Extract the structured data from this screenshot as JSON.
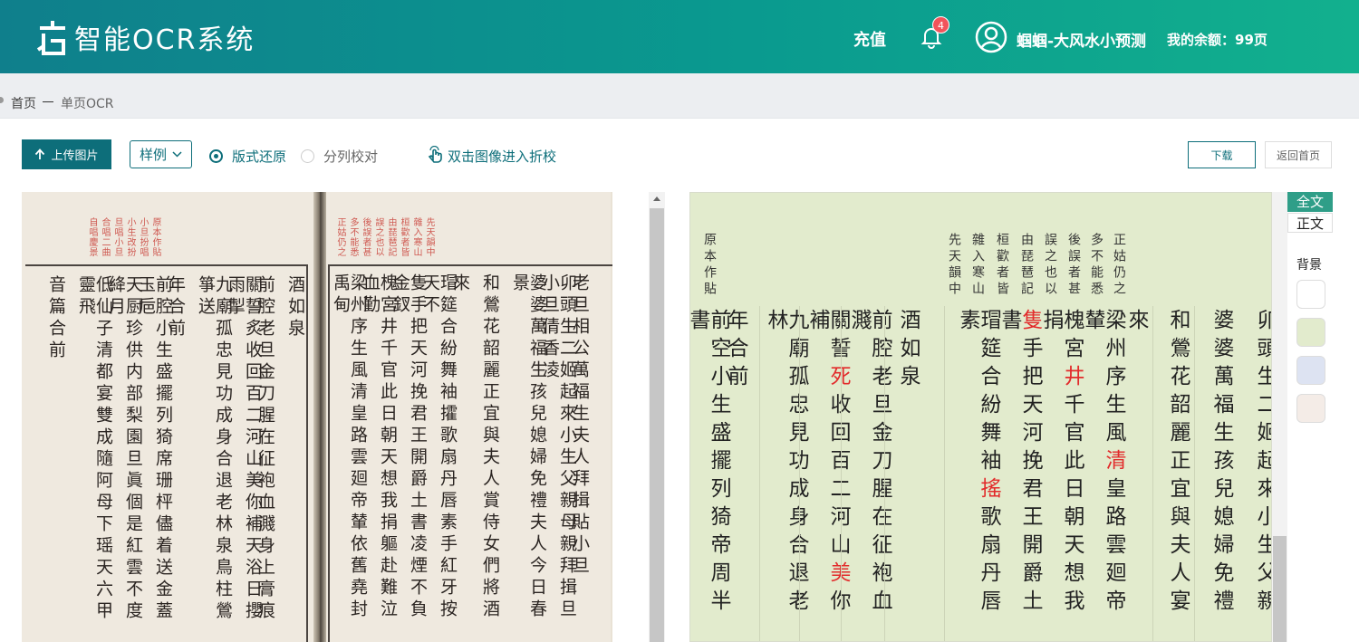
{
  "header": {
    "app_title": "智能OCR系统",
    "recharge": "充值",
    "notification_count": "4",
    "username": "蝈蝈-大风水小预测",
    "balance": "我的余额：99页"
  },
  "breadcrumb": {
    "home": "首页",
    "current": "单页OCR"
  },
  "toolbar": {
    "upload_label": "上传图片",
    "sample_label": "样例",
    "mode_layout": "版式还原",
    "mode_columns": "分列校对",
    "fold_label": "双击图像进入折校",
    "download_label": "下载",
    "home_label": "返回首页"
  },
  "side_tabs": {
    "full": "全文",
    "body": "正文",
    "background_label": "背景"
  },
  "colors": {
    "header_start": "#0f7f8c",
    "header_end": "#12b08e",
    "accent": "#0d6e7a",
    "swatches": [
      "#ffffff",
      "#e2ebcd",
      "#dde3f2",
      "#f4ece7"
    ]
  },
  "scan": {
    "left_notes": [
      "原本作貼",
      "小旦扮唱",
      "小生改扮",
      "旦唱小旦",
      "合唱二曲",
      "自唱慶景"
    ],
    "left_cols": [
      "酒如泉",
      "前腔老旦金刀腥在征袍血濺身上膏痕",
      "關誓炙收回百二河山美你補天浴日攖雨掣",
      "九廟孤忠見功成身合退老林泉鳥柱鶯箏送",
      "年合前",
      "前腔小生盛擺列猗席珊枰儘着送金蓋玉巵",
      "天厨珍供内部梨園旦眞個是紅雲不度絳月",
      "低仙子清都宴雙成隨阿母下瑶天六甲靈飛",
      "音篇合前"
    ],
    "right_notes": [
      "先天韻中",
      "雜入寒山",
      "桓歡者皆",
      "由琵琶記",
      "誤之也以",
      "後誤者甚",
      "多不能悉",
      "正姑仍之"
    ],
    "right_cols": [
      "梁州序生風清皇路雲廻帝輦依舊堯封禹甸",
      "槐宮井千官此日朝天想我捐軀赴難泣血勤",
      "隻手把天河挽君王開爵土書凌煙不負金釵",
      "瑁筵合紛舞袖攉歌扇丹唇素手紅牙按天不",
      "來",
      "和鶯花韶麗正宜與夫人賞侍女們將酒",
      "婆婆萬福生孩兒媳婦免禮夫人今日春景",
      "卯頭生二姬起來小生父親母親拜揖旦小旦倩香凌",
      "老旦相公萬福生夫人拜揖貼小旦"
    ]
  },
  "ocr": {
    "notes": [
      "原本作貼",
      "先天韻中",
      "雜入寒山",
      "桓歡者皆",
      "由琵琶記",
      "誤之也以",
      "後誤者甚",
      "多不能悉",
      "正姑仍之"
    ],
    "cols": [
      "前空小生盛擺列猗帝周半書",
      "年合前",
      "九廟孤忠見功成身合退老林",
      "關誓死收回百二河山美你補",
      "前腔老旦金刀腥在征袍血濺",
      "酒如泉",
      "瑁筵合紛舞袖搖歌扇丹唇素",
      "隻手把天河挽君王開爵土書",
      "槐宮井千官此日朝天想我捐",
      "梁州序生風清皇路雲廻帝輦",
      "來",
      "和鶯花韶麗正宜與夫人宴",
      "婆婆萬福生孩兒媳婦免禮",
      "卯頭生二姬起來小生父親"
    ]
  }
}
